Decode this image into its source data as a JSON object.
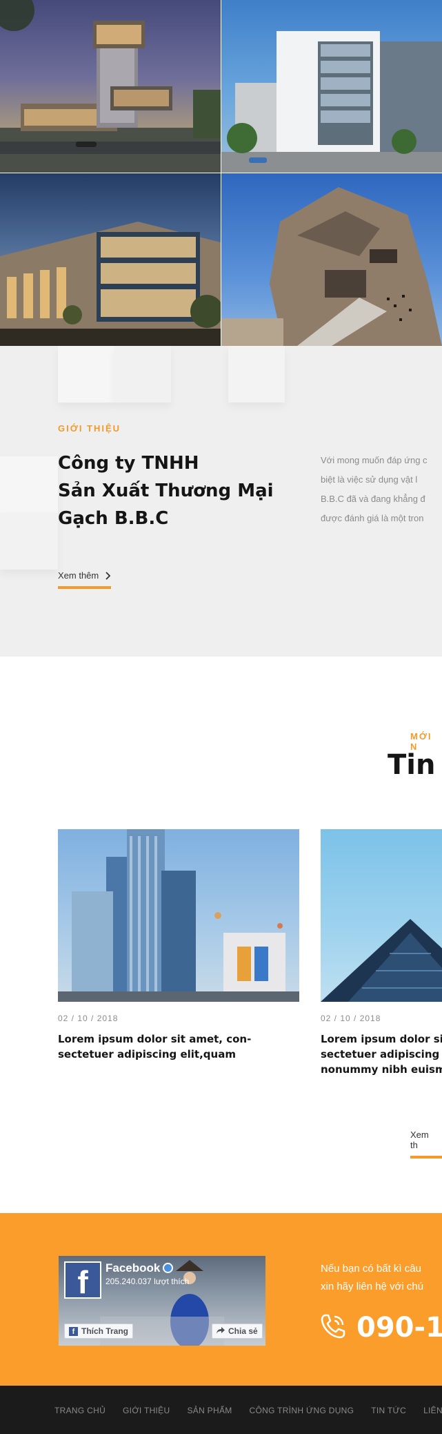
{
  "gallery": {
    "images": [
      "modern-tower-building",
      "office-building-white",
      "glass-stone-building",
      "angular-concrete-building"
    ]
  },
  "intro": {
    "eyebrow": "GIỚI THIỆU",
    "title_line1": "Công ty TNHH",
    "title_line2": "Sản Xuất Thương Mại",
    "title_line3": "Gạch B.B.C",
    "text_lines": [
      "Với mong muốn đáp ứng c",
      "biệt là việc sử dụng vật l",
      "B.B.C đã và đang khẳng đ",
      "được đánh giá là một tron"
    ],
    "more_label": "Xem thêm"
  },
  "news": {
    "eyebrow": "MỚI N",
    "title": "Tin",
    "more_label": "Xem th",
    "items": [
      {
        "date": "02 / 10 / 2018",
        "title_line1": "Lorem ipsum dolor sit amet, con-",
        "title_line2": "sectetuer adipiscing elit,quam",
        "title_line3": ""
      },
      {
        "date": "02 / 10 / 2018",
        "title_line1": "Lorem ipsum dolor si",
        "title_line2": "sectetuer adipiscing",
        "title_line3": "nonummy nibh euism"
      }
    ]
  },
  "contact": {
    "facebook": {
      "name": "Facebook",
      "likes": "205.240.037 lượt thích",
      "like_button": "Thích Trang",
      "share_button": "Chia sẻ"
    },
    "text_line1": "Nếu bạn có bất kì câu",
    "text_line2": "xin hãy liên hệ với chú",
    "phone": "090-1"
  },
  "footer": {
    "nav": [
      "TRANG CHỦ",
      "GIỚI THIỆU",
      "SẢN PHẨM",
      "CÔNG TRÌNH ỨNG DỤNG",
      "TIN TỨC",
      "LIÊN HỆ"
    ]
  },
  "colors": {
    "accent": "#f39a2b",
    "contact_bg": "#fb9d2a",
    "footer_bg": "#1b1b1b",
    "intro_bg": "#efefef"
  }
}
